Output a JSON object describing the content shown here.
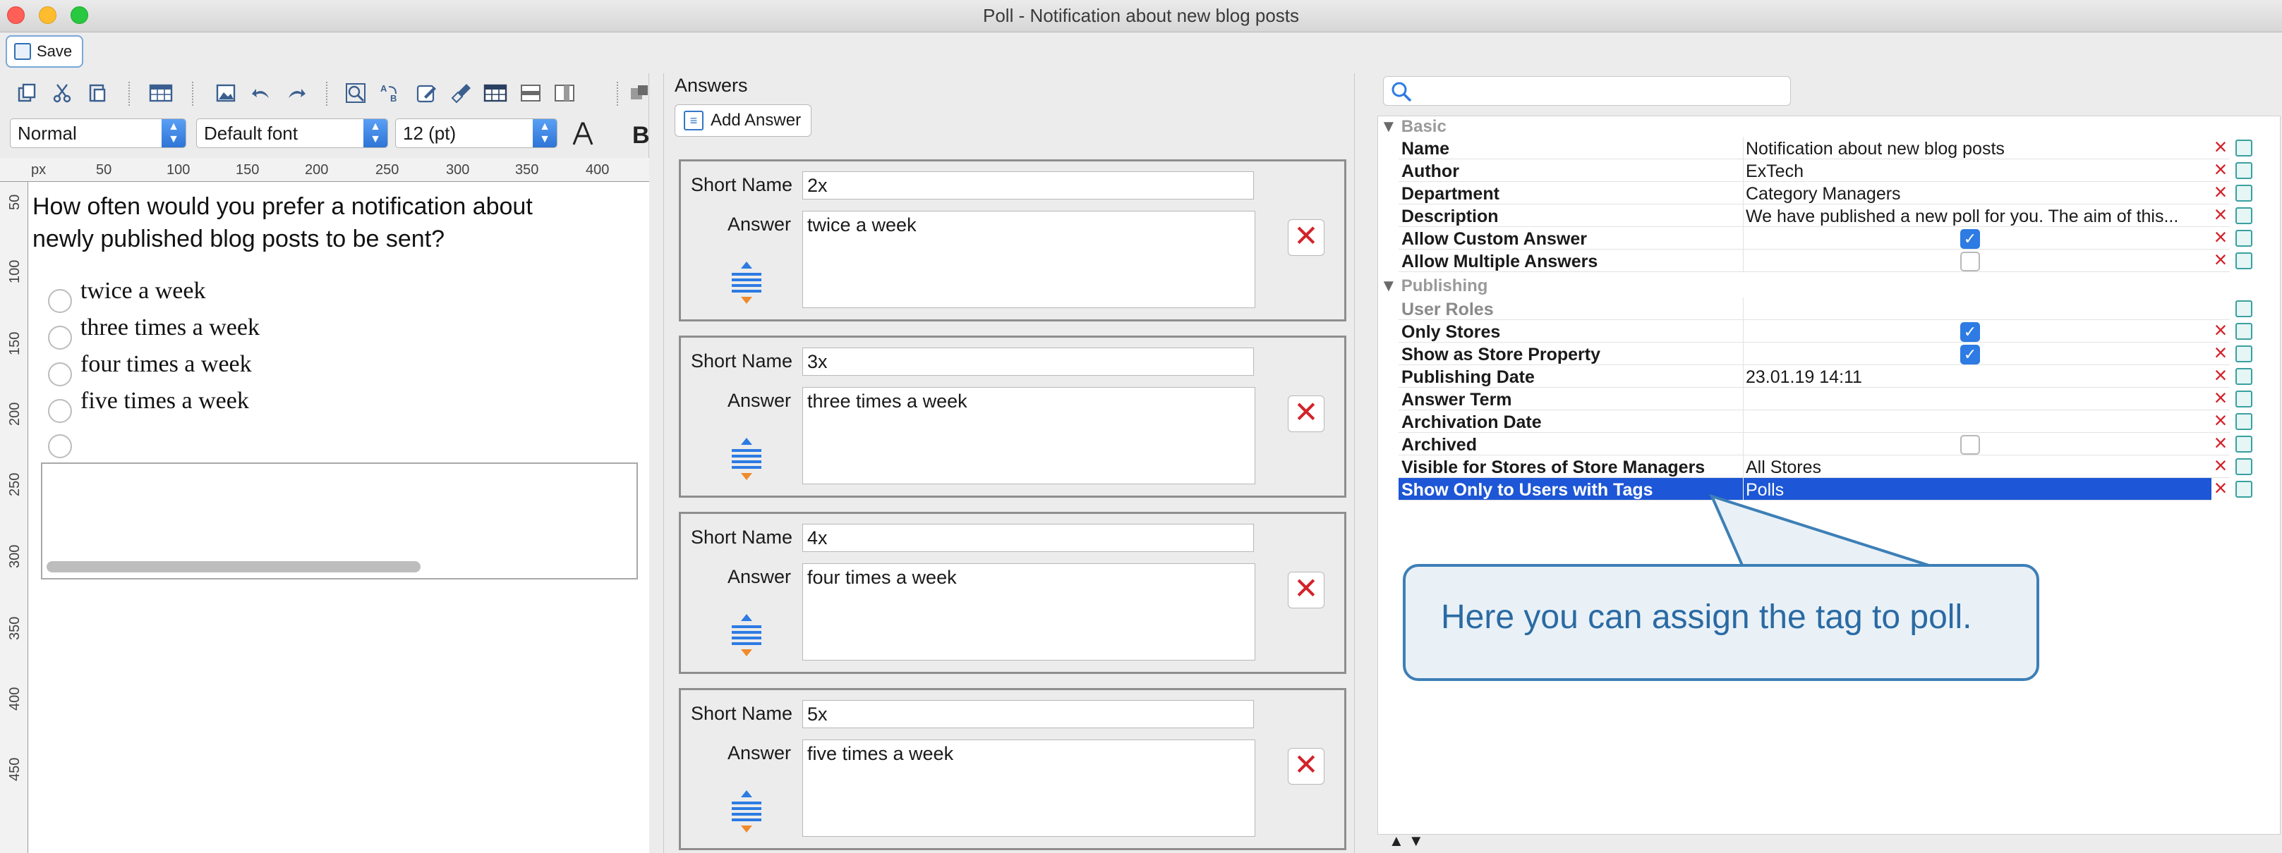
{
  "window": {
    "title": "Poll - Notification about new blog posts"
  },
  "toolbar": {
    "save_label": "Save"
  },
  "editor": {
    "style_select": "Normal",
    "font_select": "Default font",
    "size_select": "12 (pt)",
    "ruler_unit": "px",
    "ruler_top_ticks": [
      "50",
      "100",
      "150",
      "200",
      "250",
      "300",
      "350",
      "400"
    ],
    "ruler_left_ticks": [
      "50",
      "100",
      "150",
      "200",
      "250",
      "300",
      "350",
      "400",
      "450"
    ],
    "question": "How often would you prefer a notification about newly published blog posts to be sent?",
    "options": [
      "twice a week",
      "three times a week",
      "four times a week",
      "five times a week"
    ]
  },
  "answers": {
    "title": "Answers",
    "add_label": "Add Answer",
    "short_name_label": "Short Name",
    "answer_label": "Answer",
    "items": [
      {
        "short_name": "2x",
        "answer": "twice a week"
      },
      {
        "short_name": "3x",
        "answer": "three times a week"
      },
      {
        "short_name": "4x",
        "answer": "four times a week"
      },
      {
        "short_name": "5x",
        "answer": "five times a week"
      }
    ]
  },
  "properties": {
    "search_placeholder": "",
    "basic_label": "Basic",
    "publishing_label": "Publishing",
    "basic": [
      {
        "key": "Name",
        "value": "Notification about new blog posts"
      },
      {
        "key": "Author",
        "value": "ExTech"
      },
      {
        "key": "Department",
        "value": "Category Managers"
      },
      {
        "key": "Description",
        "value": "We have published a new poll for you. The aim of this..."
      },
      {
        "key": "Allow Custom Answer",
        "checkbox": true
      },
      {
        "key": "Allow Multiple Answers",
        "checkbox": false
      }
    ],
    "publishing": [
      {
        "key": "User Roles",
        "value": ""
      },
      {
        "key": "Only Stores",
        "checkbox": true
      },
      {
        "key": "Show as Store Property",
        "checkbox": true
      },
      {
        "key": "Publishing Date",
        "value": "23.01.19 14:11"
      },
      {
        "key": "Answer Term",
        "value": ""
      },
      {
        "key": "Archivation Date",
        "value": ""
      },
      {
        "key": "Archived",
        "checkbox": false
      },
      {
        "key": "Visible for Stores of Store Managers",
        "value": "All Stores"
      },
      {
        "key": "Show Only to Users with Tags",
        "value": "Polls"
      }
    ]
  },
  "callout": {
    "text": "Here you can assign the tag to poll."
  },
  "colors": {
    "selection": "#1d56d6",
    "accent": "#2d7be3",
    "delete": "#d3232a",
    "callout_border": "#3d7fb6"
  }
}
